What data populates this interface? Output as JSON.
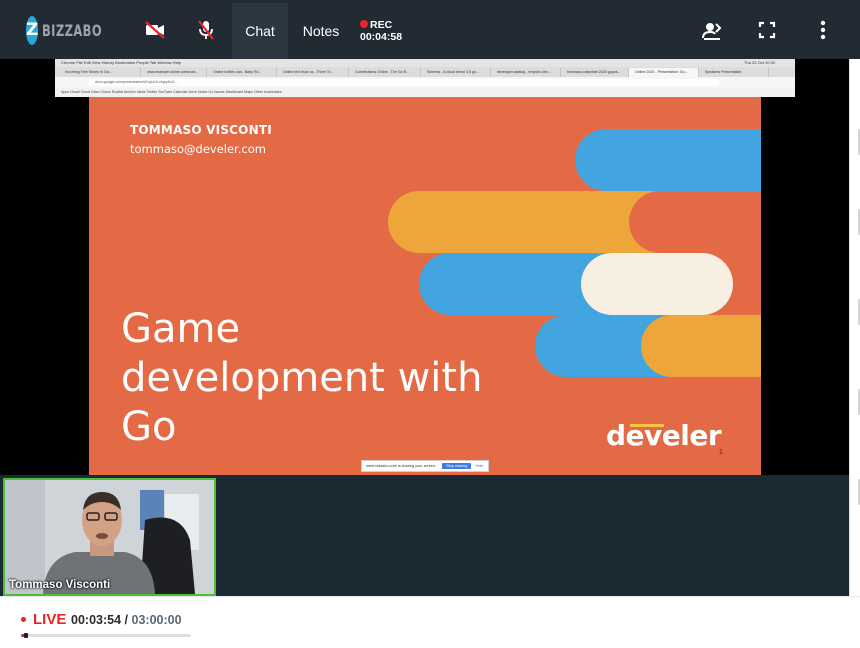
{
  "app": {
    "name": "BIZZABO",
    "logo_letter": "Z"
  },
  "topbar": {
    "icons": [
      "video-off-icon",
      "mic-off-icon"
    ],
    "tabs": [
      {
        "label": "Chat",
        "active": true
      },
      {
        "label": "Notes",
        "active": false
      }
    ],
    "rec": {
      "label": "REC",
      "time": "00:04:58"
    },
    "right_icons": [
      "switch-view-icon",
      "fullscreen-icon",
      "more-options-icon"
    ]
  },
  "browser": {
    "menu": "Chrome  File  Edit  View  History  Bookmarks  People  Tab  Window  Help",
    "clock": "Thu 22 Oct 10:30",
    "tabs": [
      "Incoming Tree Shoes In Ga...",
      "www.example.online.com/cont...",
      "Online bottles can.. Baby Ro...",
      "Online text linux us - Three To...",
      "Contributions Online - The Go B...",
      "Schema - A cloud demo 3.5 go...",
      "developer.catalog - emporio dev...",
      "tommaso.cabprhab 2020 gopos...",
      "Online 2020 - Presentation: Go...",
      "Speakers Presentation"
    ],
    "url": "docs.google.com/presentation/d/1qUnX-cfqsy1tn2...",
    "bookmarks": "Apps  Gmail  Cloud  Gdev  Chess  Rustbit  Archive  Ideas  Twitter  YouTube  Calendar  Drive  Notes  Go  Issues  Dashboard  Maps  Other bookmarks",
    "share_notice": {
      "text": "meet.bizzabo.com is sharing your screen.",
      "stop_label": "Stop sharing",
      "hide_label": "Hide"
    }
  },
  "slide": {
    "author": "TOMMASO VISCONTI",
    "email": "tommaso@develer.com",
    "title_lines": [
      "Game",
      "development with",
      "Go"
    ],
    "brand": "develer",
    "page_number": "1",
    "colors": {
      "background": "#e36a45",
      "blue": "#42a5e0",
      "yellow": "#eea63a",
      "cream": "#f6efe2",
      "orange": "#e36a45"
    }
  },
  "participant": {
    "name": "Tommaso Visconti",
    "border_color": "#4cbe3c"
  },
  "live": {
    "label": "LIVE",
    "elapsed": "00:03:54",
    "separator": "/",
    "total": "03:00:00",
    "progress_fraction": 0.0217
  },
  "colors": {
    "topbar": "#222b33",
    "live_red": "#e8252a",
    "accent_green": "#4cbe3c"
  }
}
